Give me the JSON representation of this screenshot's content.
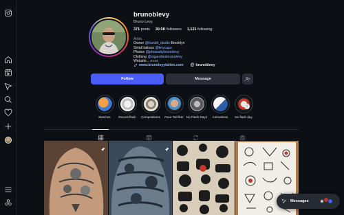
{
  "profile": {
    "username": "brunoblevy",
    "more": "···",
    "full_name": "Bruno Levy",
    "stats": {
      "posts_count": "371",
      "posts_label": "posts",
      "followers_count": "30.5K",
      "followers_label": "followers",
      "following_count": "1,121",
      "following_label": "following"
    },
    "bio": {
      "category": "Artist",
      "line1_text": "Owner ",
      "line1_link": "@bandit_studio",
      "line1_tail": " Brooklyn",
      "line2_text": "Small tattoos ",
      "line2_link": "@tinycaps",
      "line3_text": "Photos ",
      "line3_link": "@photosbybrunolevy",
      "line4_text": "Clothing ",
      "line4_link": "@cigarettesbrunolevy",
      "line5_text": "Website...",
      "line5_more": " more"
    },
    "website": "www.brunoleyytattoo.com",
    "threads": "brunoblevy"
  },
  "actions": {
    "follow": "Follow",
    "message": "Message"
  },
  "highlights": [
    {
      "label": "Matches"
    },
    {
      "label": "Recent flash"
    },
    {
      "label": "Compositions"
    },
    {
      "label": "Face Tat filter"
    },
    {
      "label": "No Flash Day2"
    },
    {
      "label": "Animations"
    },
    {
      "label": "No flash day"
    }
  ],
  "tabs": [
    "posts-grid",
    "reels",
    "reposts",
    "tagged"
  ],
  "messages": {
    "label": "Messages"
  },
  "colors": {
    "background": "#0c0f14",
    "follow_button": "#4a5df9",
    "secondary_button": "#2a2f37",
    "link": "#8fb7ff"
  },
  "icons": [
    "instagram-icon",
    "home-icon",
    "reels-icon",
    "explore-icon",
    "search-icon",
    "heart-icon",
    "create-icon",
    "menu-icon",
    "meta-icon",
    "pin-icon",
    "send-icon"
  ]
}
